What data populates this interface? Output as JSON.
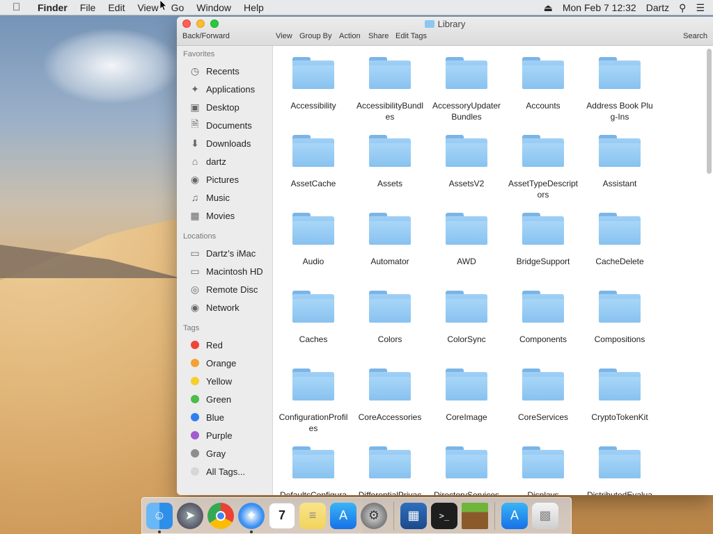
{
  "menubar": {
    "app": "Finder",
    "items": [
      "File",
      "Edit",
      "View",
      "Go",
      "Window",
      "Help"
    ],
    "datetime": "Mon Feb 7  12:32",
    "user": "Dartz"
  },
  "window": {
    "title": "Library",
    "toolbar": {
      "back_forward": "Back/Forward",
      "view": "View",
      "group_by": "Group By",
      "action": "Action",
      "share": "Share",
      "edit_tags": "Edit Tags",
      "search": "Search"
    }
  },
  "sidebar": {
    "favorites_title": "Favorites",
    "favorites": [
      "Recents",
      "Applications",
      "Desktop",
      "Documents",
      "Downloads",
      "dartz",
      "Pictures",
      "Music",
      "Movies"
    ],
    "locations_title": "Locations",
    "locations": [
      "Dartz’s iMac",
      "Macintosh HD",
      "Remote Disc",
      "Network"
    ],
    "tags_title": "Tags",
    "tags": [
      "Red",
      "Orange",
      "Yellow",
      "Green",
      "Blue",
      "Purple",
      "Gray",
      "All Tags..."
    ],
    "tag_colors": [
      "#f0433a",
      "#f5a031",
      "#f7cf2c",
      "#4cbc4a",
      "#2f7ff0",
      "#a15bd0",
      "#8e8e8e",
      "#d6d6d6"
    ]
  },
  "folders": [
    "Accessibility",
    "AccessibilityBundles",
    "AccessoryUpdaterBundles",
    "Accounts",
    "Address Book Plug-Ins",
    "AssetCache",
    "Assets",
    "AssetsV2",
    "AssetTypeDescriptors",
    "Assistant",
    "Audio",
    "Automator",
    "AWD",
    "BridgeSupport",
    "CacheDelete",
    "Caches",
    "Colors",
    "ColorSync",
    "Components",
    "Compositions",
    "ConfigurationProfiles",
    "CoreAccessories",
    "CoreImage",
    "CoreServices",
    "CryptoTokenKit",
    "DefaultsConfigura",
    "DifferentialPrivac",
    "DirectoryServices",
    "Displays",
    "DistributedEvalua"
  ]
}
